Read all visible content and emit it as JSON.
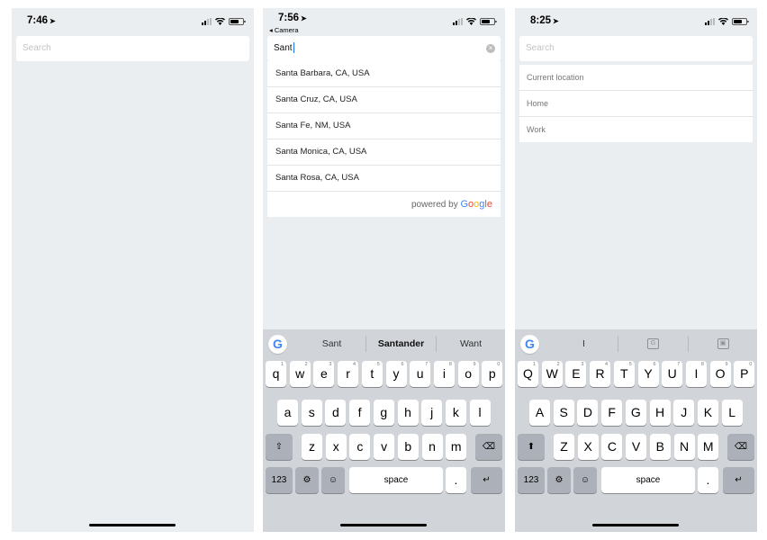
{
  "screens": [
    {
      "time": "7:46",
      "search_placeholder": "Search"
    },
    {
      "time": "7:56",
      "back_label": "◂ Camera",
      "search_value": "Sant",
      "results": [
        "Santa Barbara, CA, USA",
        "Santa Cruz, CA, USA",
        "Santa Fe, NM, USA",
        "Santa Monica, CA, USA",
        "Santa Rosa, CA, USA"
      ],
      "powered_by": "powered by",
      "google_brand": "Google",
      "keyboard": {
        "suggestions": [
          "Sant",
          "Santander",
          "Want"
        ],
        "rows": [
          [
            "q",
            "w",
            "e",
            "r",
            "t",
            "y",
            "u",
            "i",
            "o",
            "p"
          ],
          [
            "a",
            "s",
            "d",
            "f",
            "g",
            "h",
            "j",
            "k",
            "l"
          ],
          [
            "z",
            "x",
            "c",
            "v",
            "b",
            "n",
            "m"
          ]
        ],
        "number_hints": [
          "1",
          "2",
          "3",
          "4",
          "5",
          "6",
          "7",
          "8",
          "9",
          "0"
        ],
        "numbers_label": "123",
        "space_label": "space",
        "period_label": ".",
        "return_symbol": "↵",
        "shift_symbol": "⇧",
        "delete_symbol": "⌫",
        "emoji_symbol": "☺",
        "settings_symbol": "⚙"
      }
    },
    {
      "time": "8:25",
      "search_placeholder": "Search",
      "saved_places": [
        "Current location",
        "Home",
        "Work"
      ],
      "keyboard": {
        "suggestions": [
          "I"
        ],
        "translate_icon_glyph": "G",
        "image_search_icon_glyph": "▣",
        "rows": [
          [
            "Q",
            "W",
            "E",
            "R",
            "T",
            "Y",
            "U",
            "I",
            "O",
            "P"
          ],
          [
            "A",
            "S",
            "D",
            "F",
            "G",
            "H",
            "J",
            "K",
            "L"
          ],
          [
            "Z",
            "X",
            "C",
            "V",
            "B",
            "N",
            "M"
          ]
        ],
        "number_hints": [
          "1",
          "2",
          "3",
          "4",
          "5",
          "6",
          "7",
          "8",
          "9",
          "0"
        ],
        "numbers_label": "123",
        "space_label": "space",
        "period_label": ".",
        "return_symbol": "↵",
        "shift_symbol": "⬆",
        "delete_symbol": "⌫",
        "emoji_symbol": "☺",
        "settings_symbol": "⚙"
      }
    }
  ],
  "icons": {
    "location_arrow": "➤",
    "clear": "×",
    "google_g": "G"
  },
  "colors": {
    "google_blue": "#4285f4",
    "google_red": "#ea4335",
    "google_yellow": "#fbbc05",
    "google_green": "#34a853",
    "caret": "#1a73e8"
  }
}
